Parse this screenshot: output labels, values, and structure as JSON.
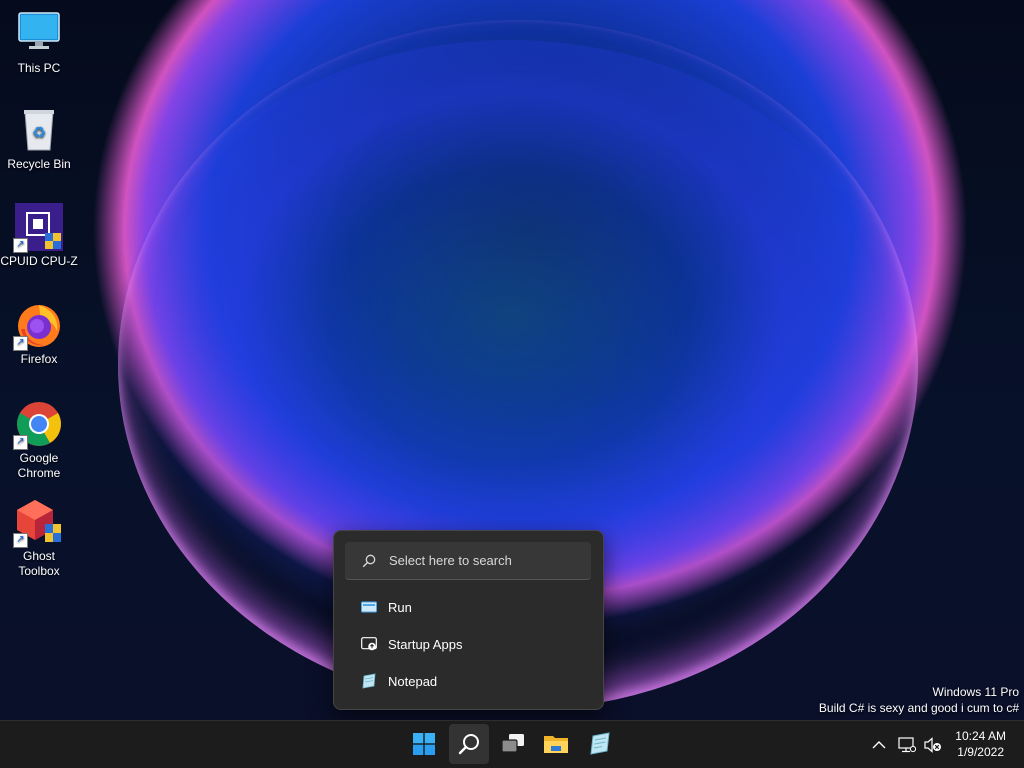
{
  "desktop_icons": [
    {
      "label": "This PC",
      "icon": "this-pc-icon"
    },
    {
      "label": "Recycle Bin",
      "icon": "recycle-bin-icon"
    },
    {
      "label": "CPUID CPU-Z",
      "icon": "cpuz-icon"
    },
    {
      "label": "Firefox",
      "icon": "firefox-icon"
    },
    {
      "label": "Google Chrome",
      "icon": "chrome-icon"
    },
    {
      "label": "Ghost Toolbox",
      "icon": "ghost-toolbox-icon"
    }
  ],
  "search_flyout": {
    "placeholder": "Select here to search",
    "items": [
      {
        "label": "Run",
        "icon": "run-icon"
      },
      {
        "label": "Startup Apps",
        "icon": "startup-apps-icon"
      },
      {
        "label": "Notepad",
        "icon": "notepad-icon"
      }
    ]
  },
  "watermark": {
    "line1": "Windows 11 Pro",
    "line2": "Build C# is sexy and good i cum to c#"
  },
  "taskbar": {
    "apps": [
      {
        "name": "start",
        "icon": "windows-logo-icon"
      },
      {
        "name": "search",
        "icon": "search-icon",
        "active": true
      },
      {
        "name": "task-view",
        "icon": "task-view-icon"
      },
      {
        "name": "file-explorer",
        "icon": "folder-icon"
      },
      {
        "name": "notepad",
        "icon": "notepad-icon"
      }
    ],
    "tray": {
      "chevron": "chevron-up-icon",
      "network": "network-icon",
      "volume": "volume-muted-icon"
    },
    "clock": {
      "time": "10:24 AM",
      "date": "1/9/2022"
    }
  },
  "colors": {
    "taskbar_bg": "#1c1c1c",
    "flyout_bg": "#2b2b2b",
    "accent": "#3a9cf0"
  }
}
